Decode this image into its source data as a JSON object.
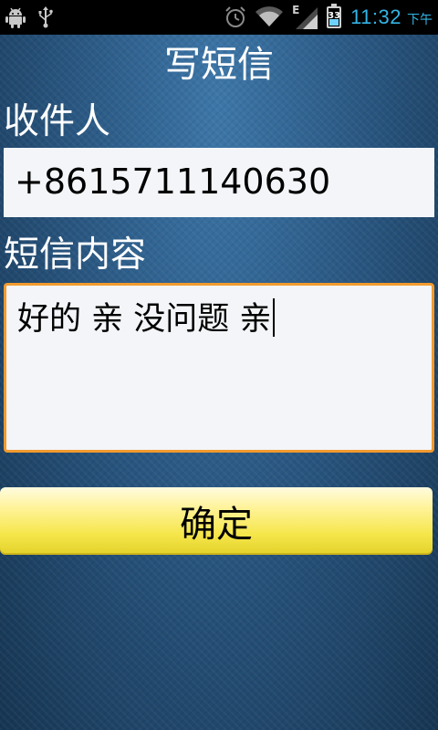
{
  "status_bar": {
    "icons_left": [
      "android-debug-icon",
      "usb-icon"
    ],
    "icons_right": [
      "alarm-icon",
      "wifi-icon",
      "signal-e-icon",
      "battery-icon"
    ],
    "network_type": "E",
    "battery_level": "33",
    "time": "11:32",
    "ampm": "下午",
    "time_color": "#33b5e5"
  },
  "app": {
    "title": "写短信",
    "recipient_label": "收件人",
    "recipient_value": "+8615711140630",
    "content_label": "短信内容",
    "content_value": "好的 亲 没问题 亲",
    "confirm_label": "确定"
  },
  "colors": {
    "background": "#2a5883",
    "message_border": "#f29a2e",
    "button": "#f5e64a"
  }
}
